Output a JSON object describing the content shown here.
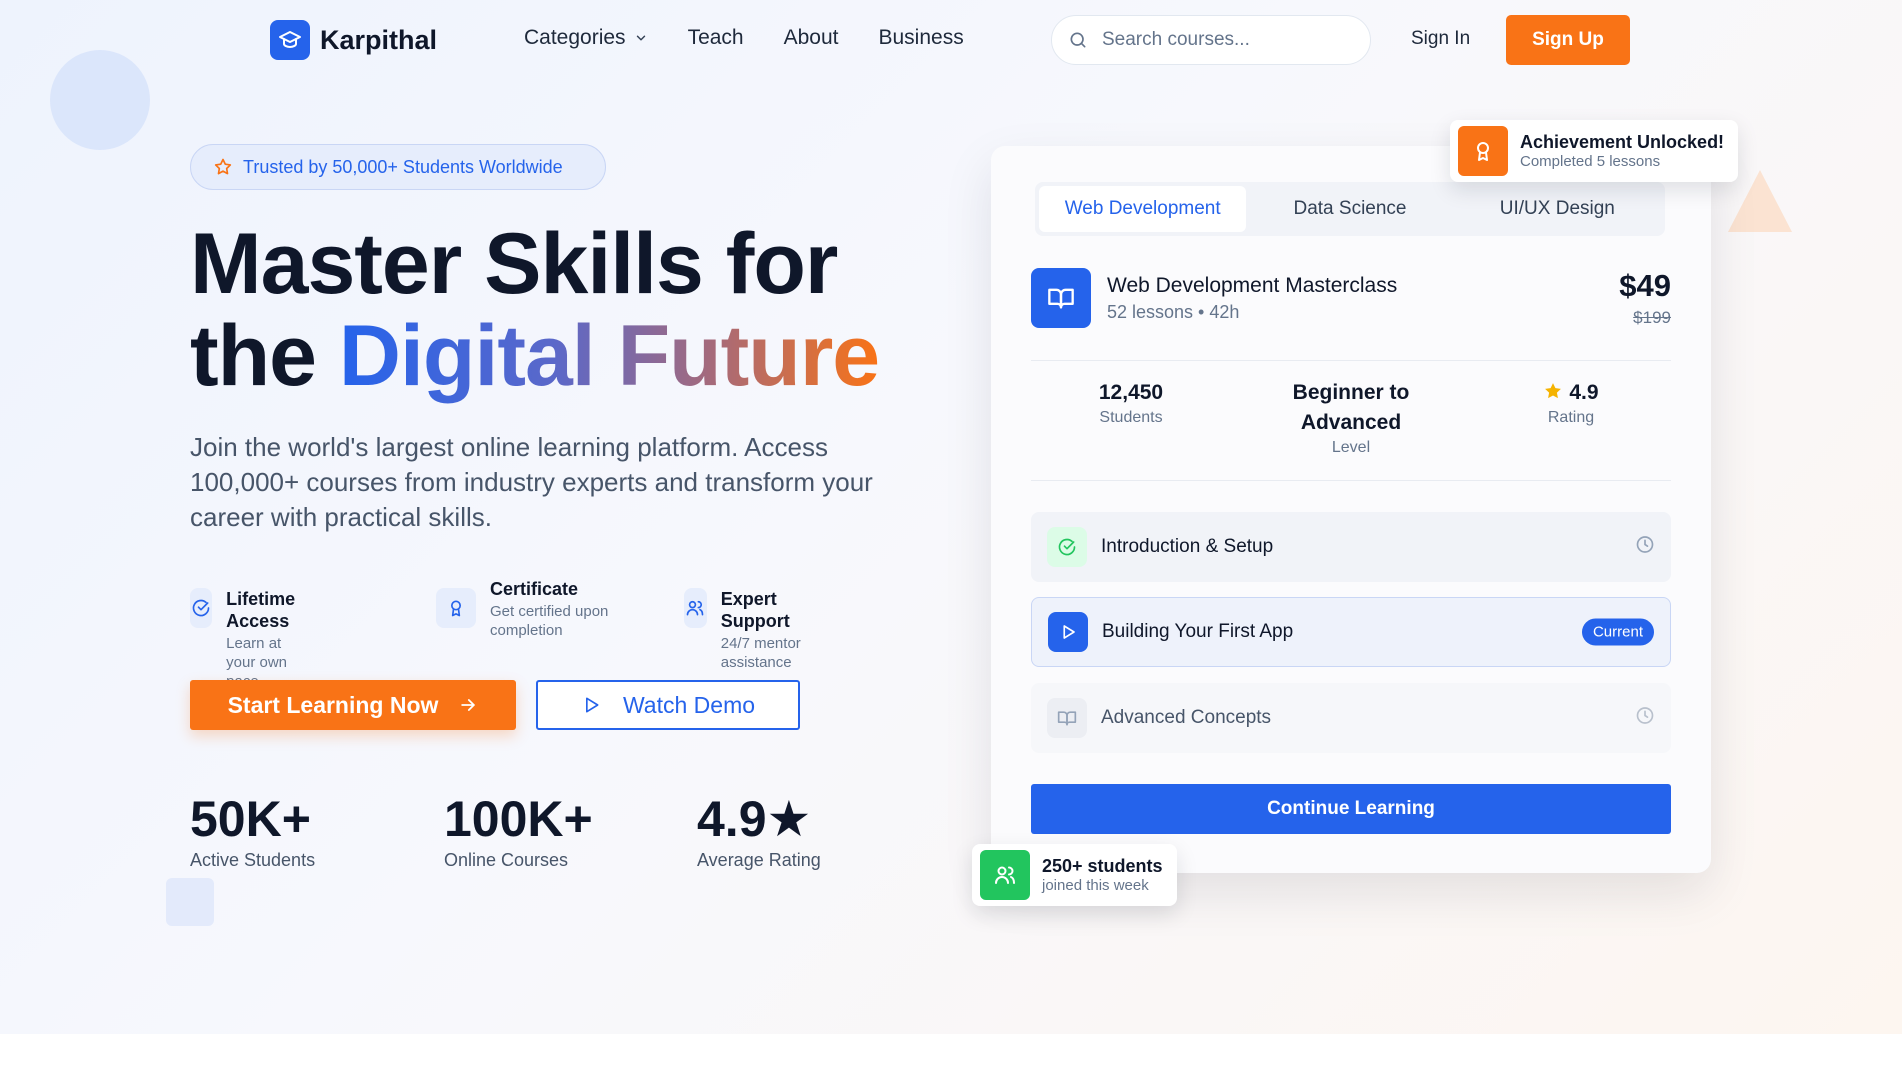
{
  "brand": {
    "name": "Karpithal",
    "accent": "#2563eb",
    "orange": "#f97316",
    "green": "#22c55e"
  },
  "nav": {
    "links": [
      "Categories",
      "Teach",
      "About",
      "Business"
    ],
    "search_placeholder": "Search courses...",
    "signin_label": "Sign In",
    "signup_label": "Sign Up"
  },
  "hero": {
    "trust_badge": "Trusted by 50,000+ Students Worldwide",
    "headline_line1": "Master Skills for",
    "headline_the": "the",
    "headline_gradient": "Digital Future",
    "subtitle": "Join the world's largest online learning platform. Access 100,000+ courses from industry experts and transform your career with practical skills.",
    "features": [
      {
        "title": "Lifetime Access",
        "desc": "Learn at your own pace",
        "icon": "check-circle-icon"
      },
      {
        "title": "Certificate",
        "desc": "Get certified upon completion",
        "icon": "award-icon"
      },
      {
        "title": "Expert Support",
        "desc": "24/7 mentor assistance",
        "icon": "users-icon"
      }
    ],
    "cta_primary": "Start Learning Now",
    "cta_secondary": "Watch Demo",
    "stats": [
      {
        "value": "50K+",
        "label": "Active Students"
      },
      {
        "value": "100K+",
        "label": "Online Courses"
      },
      {
        "value": "4.9★",
        "label": "Average Rating"
      }
    ]
  },
  "card": {
    "tabs": [
      "Web Development",
      "Data Science",
      "UI/UX Design"
    ],
    "active_tab": "Web Development",
    "course": {
      "title": "Web Development Masterclass",
      "meta": "52 lessons • 42h",
      "price": "$49",
      "old_price": "$199"
    },
    "stats": [
      {
        "value": "12,450",
        "label": "Students"
      },
      {
        "value": "Beginner to Advanced",
        "label": "Level"
      },
      {
        "value": "4.9",
        "label": "Rating"
      }
    ],
    "lessons": [
      {
        "title": "Introduction & Setup",
        "status": "completed"
      },
      {
        "title": "Building Your First App",
        "status": "current",
        "badge": "Current"
      },
      {
        "title": "Advanced Concepts",
        "status": "locked"
      }
    ],
    "continue_label": "Continue Learning"
  },
  "badges": {
    "achievement": {
      "title": "Achievement Unlocked!",
      "sub": "Completed 5 lessons"
    },
    "students": {
      "title": "250+ students",
      "sub": "joined this week"
    }
  }
}
